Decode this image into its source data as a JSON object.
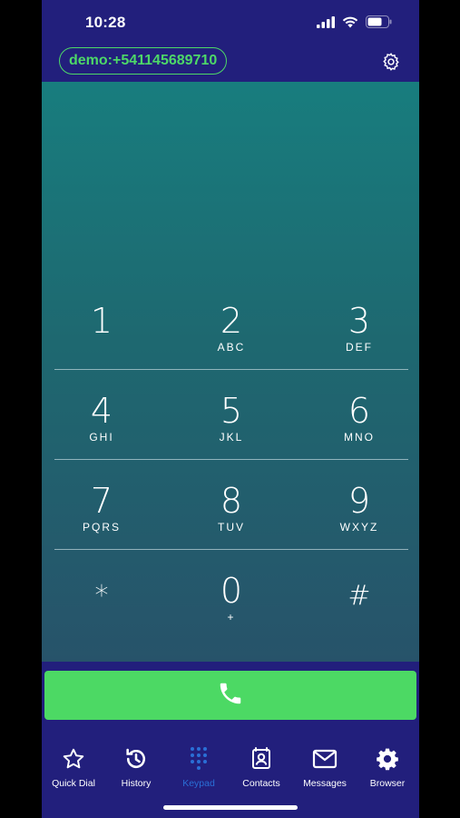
{
  "status_bar": {
    "time": "10:28"
  },
  "header": {
    "account_label": "demo:+541145689710"
  },
  "keypad": {
    "rows": [
      [
        {
          "digit": "1",
          "letters": ""
        },
        {
          "digit": "2",
          "letters": "ABC"
        },
        {
          "digit": "3",
          "letters": "DEF"
        }
      ],
      [
        {
          "digit": "4",
          "letters": "GHI"
        },
        {
          "digit": "5",
          "letters": "JKL"
        },
        {
          "digit": "6",
          "letters": "MNO"
        }
      ],
      [
        {
          "digit": "7",
          "letters": "PQRS"
        },
        {
          "digit": "8",
          "letters": "TUV"
        },
        {
          "digit": "9",
          "letters": "WXYZ"
        }
      ],
      [
        {
          "digit": "*",
          "letters": ""
        },
        {
          "digit": "0",
          "letters": "+"
        },
        {
          "digit": "#",
          "letters": ""
        }
      ]
    ]
  },
  "tabs": [
    {
      "label": "Quick Dial",
      "icon": "star-icon"
    },
    {
      "label": "History",
      "icon": "history-icon"
    },
    {
      "label": "Keypad",
      "icon": "keypad-icon",
      "active": true
    },
    {
      "label": "Contacts",
      "icon": "contacts-icon"
    },
    {
      "label": "Messages",
      "icon": "envelope-icon"
    },
    {
      "label": "Browser",
      "icon": "gear-icon"
    }
  ],
  "colors": {
    "brand_bar": "#221f7c",
    "accent_green": "#4cd964",
    "active_tab": "#2a6fd6"
  }
}
